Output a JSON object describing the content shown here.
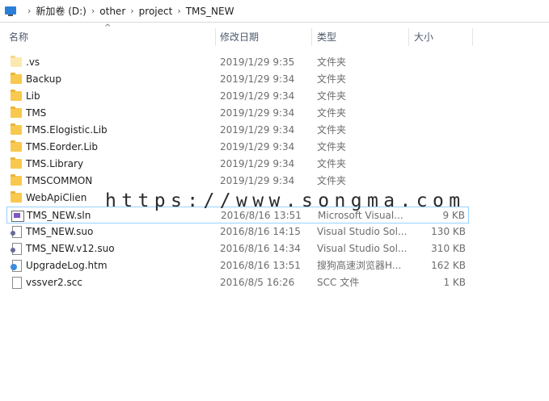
{
  "breadcrumb": [
    "新加卷 (D:)",
    "other",
    "project",
    "TMS_NEW"
  ],
  "columns": {
    "name": "名称",
    "date": "修改日期",
    "type": "类型",
    "size": "大小"
  },
  "files": [
    {
      "name": ".vs",
      "date": "2019/1/29 9:35",
      "type": "文件夹",
      "size": "",
      "icon": "folder-icon"
    },
    {
      "name": "Backup",
      "date": "2019/1/29 9:34",
      "type": "文件夹",
      "size": "",
      "icon": "folder-icon"
    },
    {
      "name": "Lib",
      "date": "2019/1/29 9:34",
      "type": "文件夹",
      "size": "",
      "icon": "folder-icon"
    },
    {
      "name": "TMS",
      "date": "2019/1/29 9:34",
      "type": "文件夹",
      "size": "",
      "icon": "folder-icon"
    },
    {
      "name": "TMS.Elogistic.Lib",
      "date": "2019/1/29 9:34",
      "type": "文件夹",
      "size": "",
      "icon": "folder-icon"
    },
    {
      "name": "TMS.Eorder.Lib",
      "date": "2019/1/29 9:34",
      "type": "文件夹",
      "size": "",
      "icon": "folder-icon"
    },
    {
      "name": "TMS.Library",
      "date": "2019/1/29 9:34",
      "type": "文件夹",
      "size": "",
      "icon": "folder-icon"
    },
    {
      "name": "TMSCOMMON",
      "date": "2019/1/29 9:34",
      "type": "文件夹",
      "size": "",
      "icon": "folder-icon"
    },
    {
      "name": "WebApiClien",
      "date": "",
      "type": "",
      "size": "",
      "icon": "folder-icon"
    },
    {
      "name": "TMS_NEW.sln",
      "date": "2016/8/16 13:51",
      "type": "Microsoft Visual...",
      "size": "9 KB",
      "icon": "solution-file-icon"
    },
    {
      "name": "TMS_NEW.suo",
      "date": "2016/8/16 14:15",
      "type": "Visual Studio Sol...",
      "size": "130 KB",
      "icon": "suo-file-icon"
    },
    {
      "name": "TMS_NEW.v12.suo",
      "date": "2016/8/16 14:34",
      "type": "Visual Studio Sol...",
      "size": "310 KB",
      "icon": "suo-file-icon"
    },
    {
      "name": "UpgradeLog.htm",
      "date": "2016/8/16 13:51",
      "type": "搜狗高速浏览器H...",
      "size": "162 KB",
      "icon": "html-file-icon"
    },
    {
      "name": "vssver2.scc",
      "date": "2016/8/5 16:26",
      "type": "SCC 文件",
      "size": "1 KB",
      "icon": "generic-file-icon"
    }
  ],
  "watermark": "https://www.songma.com"
}
